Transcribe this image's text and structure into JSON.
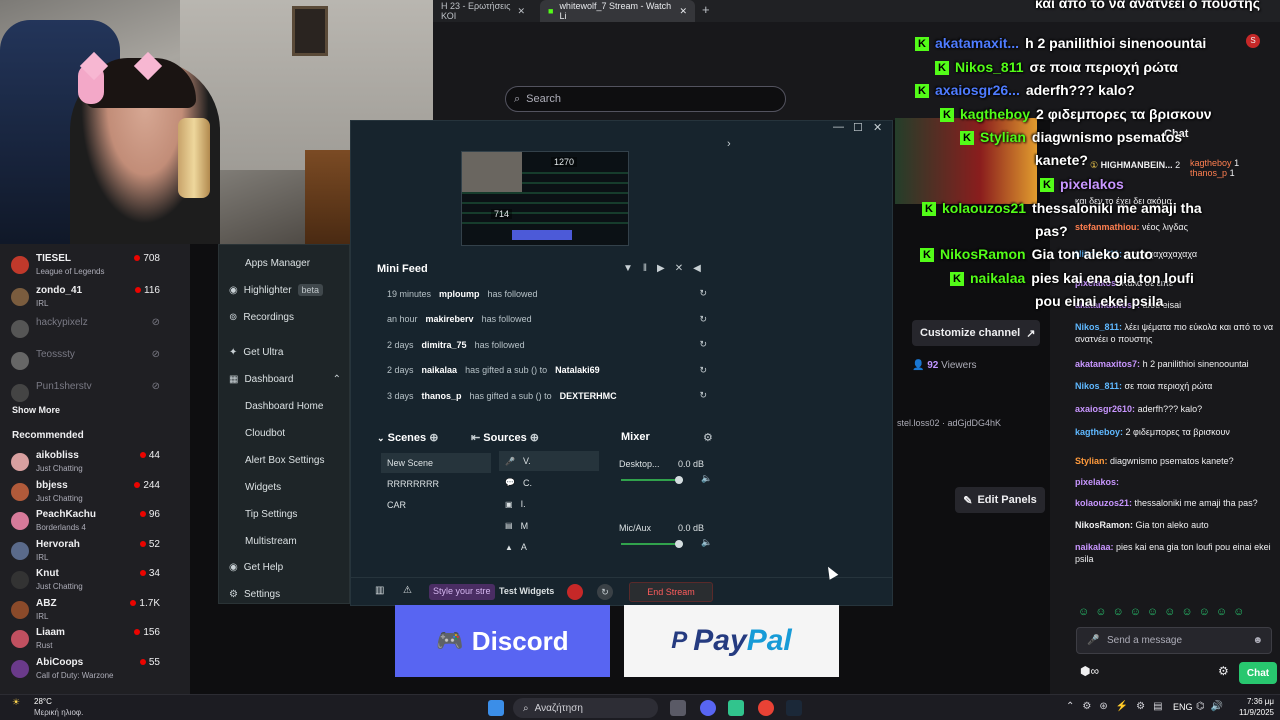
{
  "browser": {
    "tabs": [
      {
        "label": "Η 23 - Ερωτήσεις ΚΟΙ"
      },
      {
        "label": "whitewolf_7 Stream - Watch Li"
      }
    ],
    "search_placeholder": "Search",
    "profile_letter": "S"
  },
  "leftnav": {
    "followed": [
      {
        "name": "TIESEL",
        "game": "League of Legends",
        "viewers": "708",
        "avatar_color": "#c0392b",
        "live": true
      },
      {
        "name": "zondo_41",
        "game": "IRL",
        "viewers": "116",
        "avatar_color": "#7a5c3e",
        "live": true
      },
      {
        "name": "hackypixelz",
        "game": "",
        "viewers": "",
        "avatar_color": "#555",
        "live": false
      },
      {
        "name": "Teosssty",
        "game": "",
        "viewers": "",
        "avatar_color": "#666",
        "live": false
      },
      {
        "name": "Pun1sherstv",
        "game": "",
        "viewers": "",
        "avatar_color": "#444",
        "live": false
      }
    ],
    "show_more": "Show More",
    "recommended_title": "Recommended",
    "recommended": [
      {
        "name": "aikobliss",
        "game": "Just Chatting",
        "viewers": "44",
        "avatar_color": "#d8a0a0"
      },
      {
        "name": "bbjess",
        "game": "Just Chatting",
        "viewers": "244",
        "avatar_color": "#b05a3a"
      },
      {
        "name": "PeachKachu",
        "game": "Borderlands 4",
        "viewers": "96",
        "avatar_color": "#d67a9a"
      },
      {
        "name": "Hervorah",
        "game": "IRL",
        "viewers": "52",
        "avatar_color": "#5a6a8a"
      },
      {
        "name": "Knut",
        "game": "Just Chatting",
        "viewers": "34",
        "avatar_color": "#333"
      },
      {
        "name": "ABZ",
        "game": "IRL",
        "viewers": "1.7K",
        "avatar_color": "#8a4a2a"
      },
      {
        "name": "Liaam",
        "game": "Rust",
        "viewers": "156",
        "avatar_color": "#c05060"
      },
      {
        "name": "AbiCoops",
        "game": "Call of Duty: Warzone",
        "viewers": "55",
        "avatar_color": "#6a3a8a"
      }
    ]
  },
  "sl_menu": {
    "items": [
      {
        "label": "Apps Manager",
        "sub": true
      },
      {
        "label": "Highlighter",
        "badge": "beta",
        "sub": false
      },
      {
        "label": "Recordings",
        "sub": false
      },
      {
        "label": "Get Ultra",
        "sub": false
      },
      {
        "label": "Dashboard",
        "sub": false
      },
      {
        "label": "Dashboard Home",
        "sub": true
      },
      {
        "label": "Cloudbot",
        "sub": true
      },
      {
        "label": "Alert Box Settings",
        "sub": true
      },
      {
        "label": "Widgets",
        "sub": true
      },
      {
        "label": "Tip Settings",
        "sub": true
      },
      {
        "label": "Multistream",
        "sub": true
      },
      {
        "label": "Get Help",
        "sub": false
      },
      {
        "label": "Settings",
        "sub": false
      }
    ]
  },
  "preview": {
    "label_top": "1270",
    "label_bottom": "714"
  },
  "minifeed": {
    "title": "Mini Feed",
    "events": [
      {
        "time": "19 minutes",
        "user": "mploump",
        "action": "has followed",
        "target": ""
      },
      {
        "time": "an hour",
        "user": "makireberv",
        "action": "has followed",
        "target": ""
      },
      {
        "time": "2 days",
        "user": "dimitra_75",
        "action": "has followed",
        "target": ""
      },
      {
        "time": "2 days",
        "user": "naikalaa",
        "action": "has gifted a sub () to",
        "target": "Natalaki69"
      },
      {
        "time": "3 days",
        "user": "thanos_p",
        "action": "has gifted a sub () to",
        "target": "DEXTERHMC"
      }
    ]
  },
  "docks": {
    "scenes_title": "Scenes",
    "scenes": [
      "New Scene",
      "RRRRRRRR",
      "CAR"
    ],
    "sources_title": "Sources",
    "sources": [
      "V.",
      "C.",
      "I.",
      "M",
      "A"
    ],
    "mixer_title": "Mixer",
    "mixer": [
      {
        "name": "Desktop...",
        "level": "0.0 dB"
      },
      {
        "name": "Mic/Aux",
        "level": "0.0 dB"
      }
    ]
  },
  "sl_bottom": {
    "style_label": "Style your stre",
    "test_widgets": "Test Widgets",
    "end_stream": "End Stream"
  },
  "twitch": {
    "customize_channel": "Customize channel",
    "viewers": "92",
    "viewers_label": "Viewers",
    "tags": "stel.loss02 · adGjdDG4hK",
    "edit_panels": "Edit Panels"
  },
  "panels": {
    "discord": "Discord",
    "paypal_a": "Pay",
    "paypal_b": "Pal"
  },
  "chat": {
    "header": "Chat",
    "top_users": [
      {
        "name": "HIGHMANBEIN...",
        "count": "2"
      },
      {
        "name": "kagtheboy",
        "count": "1"
      },
      {
        "name": "thanos_p",
        "count": "1"
      }
    ],
    "messages": [
      {
        "user": "",
        "text": "και δεν το έχει δει ακόμα",
        "color": "#efeff1"
      },
      {
        "user": "stefanmathiou:",
        "text": "νέος λιγδας",
        "color": "#ff7f50"
      },
      {
        "user": "Nikos_811:",
        "text": "χαχχαχαχαχαχαχα",
        "color": "#5fb8ff"
      },
      {
        "user": "pixelakos:",
        "text": "Καλα σε ειπε",
        "color": "#c896ff"
      },
      {
        "user": "akatamaxitos7:",
        "text": "afou eisai",
        "color": "#c896ff"
      },
      {
        "user": "Nikos_811:",
        "text": "λέει ψέματα πιο εύκολα και από το να ανατνέει ο πουστης",
        "color": "#5fb8ff"
      },
      {
        "user": "akatamaxitos7:",
        "text": "h 2 panilithioi sinenoountai",
        "color": "#c896ff"
      },
      {
        "user": "Nikos_811:",
        "text": "σε ποια περιοχή ρώτα",
        "color": "#5fb8ff"
      },
      {
        "user": "axaiosgr2610:",
        "text": "aderfh??? kalo?",
        "color": "#c896ff"
      },
      {
        "user": "kagtheboy:",
        "text": "2 φιδεμπορες τα βρισκουν",
        "color": "#5fb8ff"
      },
      {
        "user": "Stylian:",
        "text": "diagwnismo psematos kanete?",
        "color": "#ff9a3c"
      },
      {
        "user": "pixelakos:",
        "text": "",
        "color": "#c896ff"
      },
      {
        "user": "kolaouzos21:",
        "text": "thessaloniki me amaji tha pas?",
        "color": "#c896ff"
      },
      {
        "user": "NikosRamon:",
        "text": "Gia ton aleko auto",
        "color": "#efeff1"
      },
      {
        "user": "naikalaa:",
        "text": "pies kai ena gia ton loufi pou einai ekei psila",
        "color": "#c896ff"
      }
    ],
    "input_placeholder": "Send a message",
    "send_label": "Chat"
  },
  "overlay_chat": [
    {
      "user": "",
      "text": "και από το να ανατνέει ο πουστης",
      "color": "#fff"
    },
    {
      "user": "akatamaxit...",
      "text": "h 2 panilithioi sinenoountai",
      "color": "#4f7cff"
    },
    {
      "user": "Nikos_811",
      "text": "σε ποια περιοχή ρώτα",
      "color": "#53fc18"
    },
    {
      "user": "axaiosgr26...",
      "text": "aderfh??? kalo?",
      "color": "#4f7cff"
    },
    {
      "user": "kagtheboy",
      "text": "2 φιδεμπορες τα βρισκουν",
      "color": "#53fc18"
    },
    {
      "user": "Stylian",
      "text": "diagwnismo psematos",
      "color": "#53fc18"
    },
    {
      "user": "",
      "text": "kanete?",
      "color": "#fff"
    },
    {
      "user": "pixelakos",
      "text": "",
      "color": "#c896ff"
    },
    {
      "user": "kolaouzos21",
      "text": "thessaloniki me amaji tha",
      "color": "#53fc18"
    },
    {
      "user": "",
      "text": "pas?",
      "color": "#fff"
    },
    {
      "user": "NikosRamon",
      "text": "Gia ton aleko auto",
      "color": "#53fc18"
    },
    {
      "user": "naikalaa",
      "text": "pies kai ena gia ton loufi",
      "color": "#53fc18"
    },
    {
      "user": "",
      "text": "pou einai ekei psila",
      "color": "#fff"
    }
  ],
  "taskbar": {
    "weather_temp": "28°C",
    "weather_desc": "Μερική ηλιοφ.",
    "search": "Αναζήτηση",
    "lang": "ENG",
    "time": "7:36 μμ",
    "date": "11/9/2025"
  }
}
